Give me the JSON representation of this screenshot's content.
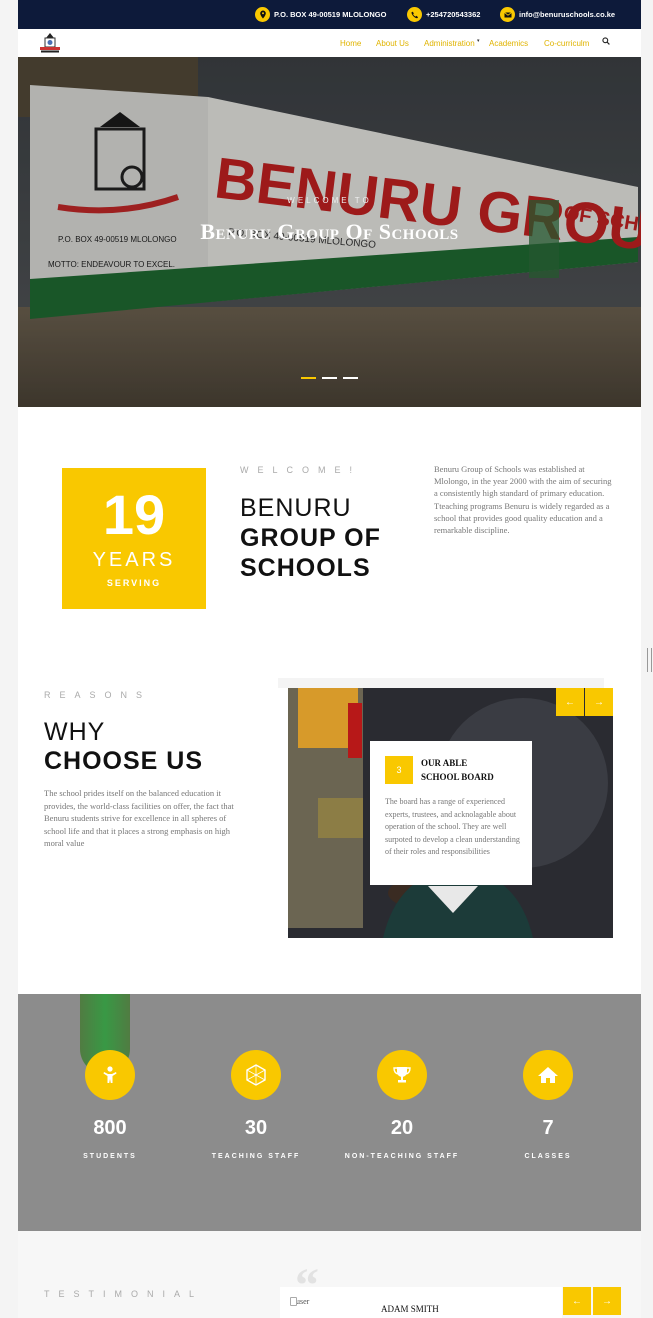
{
  "topbar": {
    "address": "P.O. BOX 49-00519 MLOLONGO",
    "phone": "+254720543362",
    "email": "info@benuruschools.co.ke"
  },
  "nav": {
    "items": [
      "Home",
      "About Us",
      "Administration",
      "Academics",
      "Co-curriculm"
    ]
  },
  "hero": {
    "kicker": "WELCOME TO",
    "title": "Benuru Group Of Schools",
    "slides": 3,
    "active_slide": 1
  },
  "about": {
    "years_number": "19",
    "years_label": "YEARS",
    "years_sub": "SERVING",
    "eyebrow": "WELCOME!",
    "heading_light": "BENURU",
    "heading_bold_1": "GROUP OF",
    "heading_bold_2": "SCHOOLS",
    "text": "Benuru Group of Schools was established at Mlolongo, in the year 2000 with the aim of securing a consistently high standard of primary education. Tteaching programs Benuru is widely regarded as a school that provides good quality education and a remarkable discipline."
  },
  "reasons": {
    "eyebrow": "REASONS",
    "heading_light": "WHY",
    "heading_bold": "CHOOSE US",
    "text": "The school prides itself on the balanced education it provides, the world-class facilities on offer, the fact that Benuru students strive for excellence in all spheres of school life and that it places a strong emphasis on high moral value",
    "card": {
      "number": "3",
      "title_line1": "OUR ABLE",
      "title_line2": "SCHOOL BOARD",
      "text": "The board has a range of experienced experts, trustees, and acknolagable about operation of the school. They are well surpoted to develop a clean understanding of their roles and responsibilities"
    }
  },
  "stats": [
    {
      "icon": "child-icon",
      "value": "800",
      "label": "STUDENTS"
    },
    {
      "icon": "polygon-icon",
      "value": "30",
      "label": "TEACHING STAFF"
    },
    {
      "icon": "trophy-icon",
      "value": "20",
      "label": "NON-TEACHING STAFF"
    },
    {
      "icon": "home-icon",
      "value": "7",
      "label": "CLASSES"
    }
  ],
  "testimonial": {
    "eyebrow": "TESTIMONIAL",
    "image_alt": "user",
    "name": "ADAM SMITH"
  },
  "colors": {
    "accent": "#f9c800",
    "topbar": "#0d1a3a",
    "stats_bg": "#8c8c8c"
  }
}
